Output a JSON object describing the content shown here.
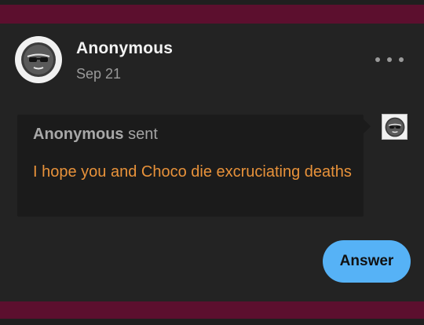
{
  "post": {
    "author": "Anonymous",
    "date": "Sep 21",
    "avatar_icon": "anonymous-sunglasses-icon",
    "more_icon": "more-options-icon"
  },
  "ask": {
    "sender_name": "Anonymous",
    "sender_verb": "sent",
    "message": "I hope you and Choco die excruciating deaths",
    "asker_avatar_icon": "anonymous-sunglasses-icon"
  },
  "actions": {
    "answer_label": "Answer"
  },
  "colors": {
    "background": "#232323",
    "stripe": "#5c0f2e",
    "bubble": "#1b1b1b",
    "message_text": "#e8923a",
    "answer_button": "#56b2f6"
  }
}
